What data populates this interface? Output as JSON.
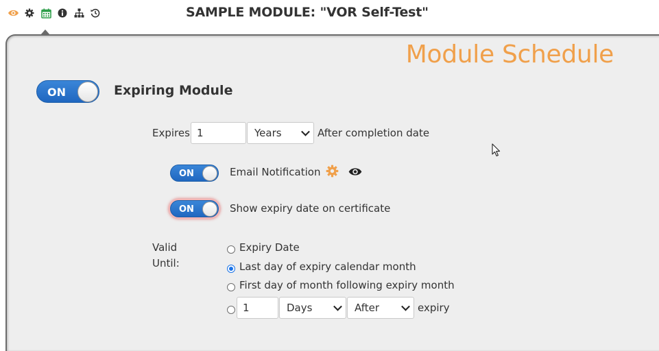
{
  "toolbar": {
    "icons": [
      {
        "name": "eye-icon",
        "color": "#f0a04b"
      },
      {
        "name": "gear-icon",
        "color": "#333333"
      },
      {
        "name": "calendar-icon",
        "color": "#2e9e4a"
      },
      {
        "name": "info-icon",
        "color": "#333333"
      },
      {
        "name": "sitemap-icon",
        "color": "#333333"
      },
      {
        "name": "history-icon",
        "color": "#333333"
      }
    ],
    "active": "calendar-icon"
  },
  "header": {
    "title": "SAMPLE MODULE: \"VOR Self-Test\""
  },
  "panel": {
    "title": "Module Schedule",
    "title_color": "#f0a04b"
  },
  "expiring": {
    "toggle_label": "ON",
    "toggle_on": true,
    "title": "Expiring Module"
  },
  "expires": {
    "label": "Expires",
    "value": "1",
    "unit": "Years",
    "suffix": "After completion date"
  },
  "email_notification": {
    "toggle_label": "ON",
    "toggle_on": true,
    "label": "Email Notification"
  },
  "show_expiry": {
    "toggle_label": "ON",
    "toggle_on": true,
    "label": "Show expiry date on certificate"
  },
  "valid_until": {
    "label_line1": "Valid",
    "label_line2": "Until:",
    "options": [
      {
        "label": "Expiry Date",
        "checked": false
      },
      {
        "label": "Last day of expiry calendar month",
        "checked": true
      },
      {
        "label": "First day of month following expiry month",
        "checked": false
      }
    ],
    "custom": {
      "checked": false,
      "value": "1",
      "unit": "Days",
      "direction": "After",
      "suffix": "expiry"
    }
  },
  "colors": {
    "toggle_blue": "#2a74cd",
    "accent_orange": "#f0a04b",
    "calendar_green": "#2e9e4a"
  }
}
